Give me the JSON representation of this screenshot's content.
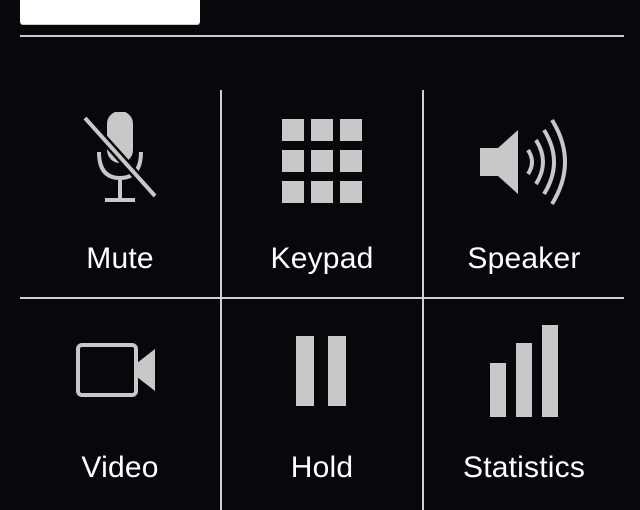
{
  "controls": {
    "mute": {
      "label": "Mute",
      "icon": "microphone-muted-icon"
    },
    "keypad": {
      "label": "Keypad",
      "icon": "keypad-icon"
    },
    "speaker": {
      "label": "Speaker",
      "icon": "speaker-icon"
    },
    "video": {
      "label": "Video",
      "icon": "video-camera-icon"
    },
    "hold": {
      "label": "Hold",
      "icon": "pause-icon"
    },
    "statistics": {
      "label": "Statistics",
      "icon": "signal-bars-icon"
    }
  },
  "colors": {
    "background": "#07080c",
    "icon": "#c8c8c8",
    "label": "#ffffff",
    "divider": "#d0d0d0"
  }
}
